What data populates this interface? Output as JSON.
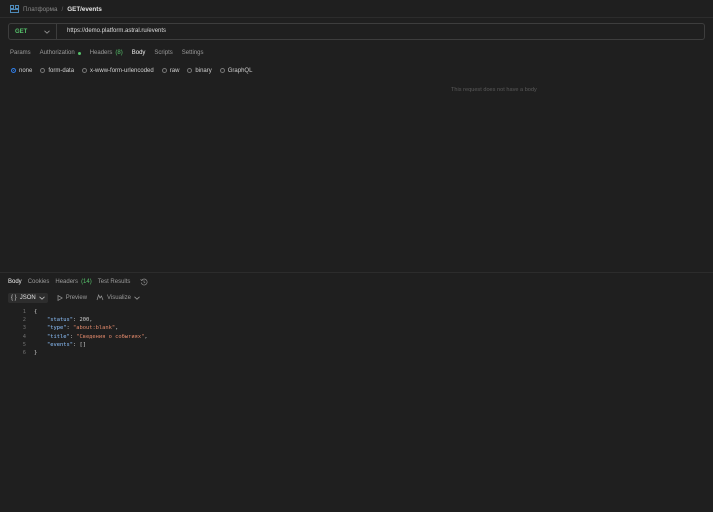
{
  "breadcrumb": {
    "collection": "Платформа",
    "separator": "/",
    "request": "GET/events"
  },
  "request": {
    "method": "GET",
    "url": "https://demo.platform.astral.ru/events",
    "tabs": [
      {
        "label": "Params"
      },
      {
        "label": "Authorization"
      },
      {
        "label": "Headers",
        "count": "(8)"
      },
      {
        "label": "Body"
      },
      {
        "label": "Scripts"
      },
      {
        "label": "Settings"
      }
    ],
    "active_tab": "Body",
    "body_types": [
      "none",
      "form-data",
      "x-www-form-urlencoded",
      "raw",
      "binary",
      "GraphQL"
    ],
    "selected_body_type": "none",
    "empty_body_message": "This request does not have a body"
  },
  "response": {
    "tabs": [
      {
        "label": "Body"
      },
      {
        "label": "Cookies"
      },
      {
        "label": "Headers",
        "count": "(14)"
      },
      {
        "label": "Test Results"
      }
    ],
    "active_tab": "Body",
    "format": "JSON",
    "preview_label": "Preview",
    "visualize_label": "Visualize",
    "code_lines": [
      {
        "num": "1",
        "text": "{"
      },
      {
        "num": "2",
        "key": "\"status\"",
        "value": "200",
        "value_type": "number",
        "trail": ","
      },
      {
        "num": "3",
        "key": "\"type\"",
        "value": "\"about:blank\"",
        "value_type": "string",
        "trail": ","
      },
      {
        "num": "4",
        "key": "\"title\"",
        "value": "\"Сведения о событиях\"",
        "value_type": "string",
        "trail": ","
      },
      {
        "num": "5",
        "key": "\"events\"",
        "value": "[]",
        "value_type": "array",
        "trail": ""
      },
      {
        "num": "6",
        "text": "}"
      }
    ]
  },
  "colors": {
    "accent_green": "#56c26b",
    "radio_blue": "#2f7de6",
    "json_key": "#8ec3ff",
    "json_string": "#e38a6c"
  }
}
